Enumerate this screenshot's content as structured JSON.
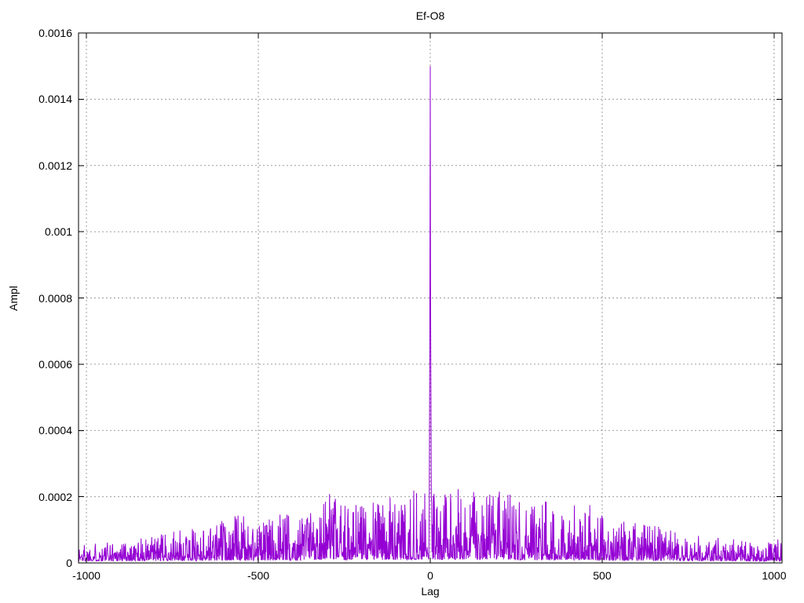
{
  "chart_data": {
    "type": "line",
    "title": "Ef-O8",
    "xlabel": "Lag",
    "ylabel": "Ampl",
    "xlim": [
      -1023,
      1023
    ],
    "ylim": [
      0,
      0.0016
    ],
    "grid": true,
    "legend": "none",
    "background_color": "#ffffff",
    "line_color": "#9400d3",
    "grid_color": "#9c9c9c",
    "border_color": "#000000",
    "xticks": [
      {
        "value": -1000,
        "label": "-1000"
      },
      {
        "value": -500,
        "label": "-500"
      },
      {
        "value": 0,
        "label": "0"
      },
      {
        "value": 500,
        "label": "500"
      },
      {
        "value": 1000,
        "label": "1000"
      }
    ],
    "yticks": [
      {
        "value": 0,
        "label": "0"
      },
      {
        "value": 0.0002,
        "label": "0.0002"
      },
      {
        "value": 0.0004,
        "label": "0.0004"
      },
      {
        "value": 0.0006,
        "label": "0.0006"
      },
      {
        "value": 0.0008,
        "label": "0.0008"
      },
      {
        "value": 0.001,
        "label": "0.001"
      },
      {
        "value": 0.0012,
        "label": "0.0012"
      },
      {
        "value": 0.0014,
        "label": "0.0014"
      },
      {
        "value": 0.0016,
        "label": "0.0016"
      }
    ],
    "peak_points": [
      {
        "lag": -3,
        "ampl": 0.00018
      },
      {
        "lag": -2,
        "ampl": 0.00045
      },
      {
        "lag": -1,
        "ampl": 0.00086
      },
      {
        "lag": 0,
        "ampl": 0.0015
      },
      {
        "lag": 1,
        "ampl": 0.0008
      },
      {
        "lag": 2,
        "ampl": 0.0005
      },
      {
        "lag": 3,
        "ampl": 0.0002
      }
    ],
    "noise": {
      "seed": 1337,
      "lag_step": 1,
      "base_amplitude": 4e-06,
      "floor_fraction": 0.03,
      "spike_exponent": 2.5,
      "envelope_keypoints": [
        [
          -1023,
          6e-05
        ],
        [
          -950,
          6e-05
        ],
        [
          -900,
          7e-05
        ],
        [
          -850,
          7e-05
        ],
        [
          -800,
          8e-05
        ],
        [
          -750,
          9e-05
        ],
        [
          -700,
          0.0001
        ],
        [
          -650,
          0.00011
        ],
        [
          -600,
          0.00013
        ],
        [
          -560,
          0.00015
        ],
        [
          -520,
          0.00012
        ],
        [
          -480,
          0.00013
        ],
        [
          -430,
          0.00016
        ],
        [
          -400,
          0.00014
        ],
        [
          -360,
          0.00016
        ],
        [
          -320,
          0.00019
        ],
        [
          -290,
          0.00021
        ],
        [
          -260,
          0.00017
        ],
        [
          -230,
          0.00018
        ],
        [
          -200,
          0.00019
        ],
        [
          -170,
          0.00021
        ],
        [
          -140,
          0.00018
        ],
        [
          -110,
          0.00021
        ],
        [
          -80,
          0.00019
        ],
        [
          -50,
          0.00022
        ],
        [
          -25,
          0.0002
        ],
        [
          0,
          0.00023
        ],
        [
          25,
          0.0002
        ],
        [
          60,
          0.00021
        ],
        [
          100,
          0.00023
        ],
        [
          140,
          0.0002
        ],
        [
          180,
          0.00021
        ],
        [
          220,
          0.00022
        ],
        [
          260,
          0.00019
        ],
        [
          300,
          0.00018
        ],
        [
          340,
          0.00019
        ],
        [
          380,
          0.00017
        ],
        [
          440,
          0.00019
        ],
        [
          480,
          0.00016
        ],
        [
          520,
          0.00014
        ],
        [
          560,
          0.00013
        ],
        [
          600,
          0.00012
        ],
        [
          650,
          0.00011
        ],
        [
          700,
          0.0001
        ],
        [
          750,
          9e-05
        ],
        [
          800,
          8e-05
        ],
        [
          850,
          7e-05
        ],
        [
          900,
          7e-05
        ],
        [
          950,
          6e-05
        ],
        [
          1023,
          7e-05
        ]
      ]
    }
  }
}
